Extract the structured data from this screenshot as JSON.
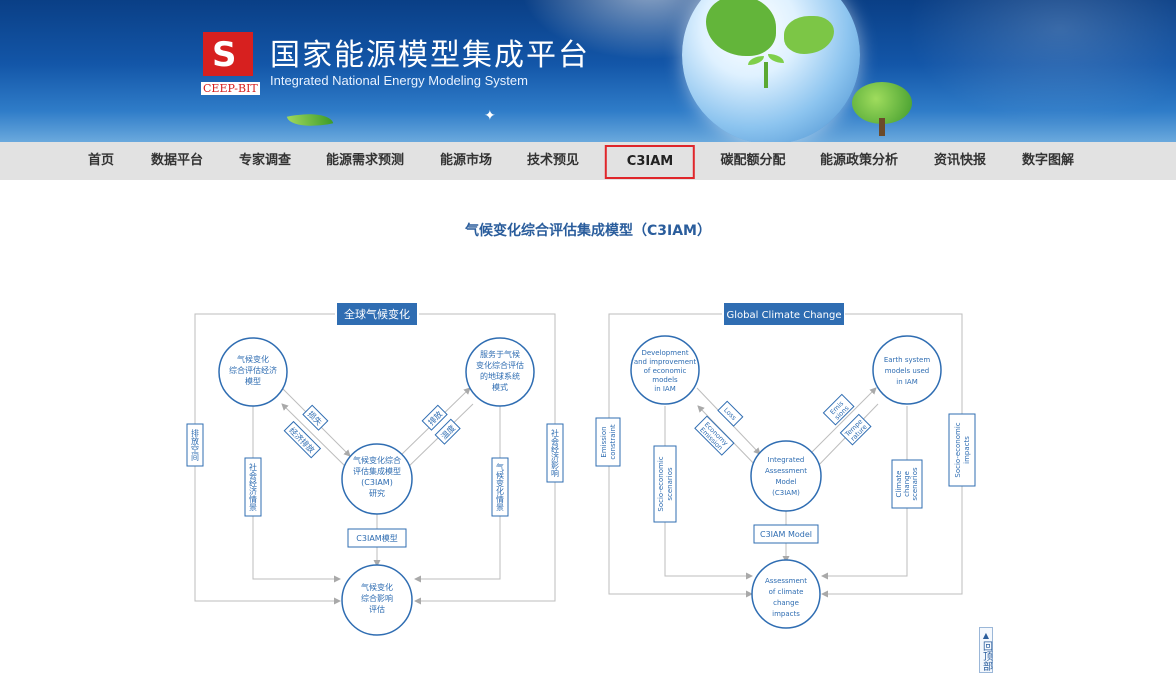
{
  "header": {
    "title": "国家能源模型集成平台",
    "subtitle": "Integrated National Energy Modeling System",
    "logo_text": "CEEP-BIT"
  },
  "nav": {
    "items": [
      {
        "label": "首页"
      },
      {
        "label": "数据平台"
      },
      {
        "label": "专家调查"
      },
      {
        "label": "能源需求预测"
      },
      {
        "label": "能源市场"
      },
      {
        "label": "技术预见"
      },
      {
        "label": "C3IAM",
        "active": true
      },
      {
        "label": "碳配额分配"
      },
      {
        "label": "能源政策分析"
      },
      {
        "label": "资讯快报"
      },
      {
        "label": "数字图解"
      }
    ]
  },
  "main": {
    "title": "气候变化综合评估集成模型（C3IAM）"
  },
  "diagram_cn": {
    "top": "全球气候变化",
    "left_circle": [
      "气候变化",
      "综合评估经济",
      "模型"
    ],
    "right_circle": [
      "服务于气候",
      "变化综合评估",
      "的地球系统",
      "模式"
    ],
    "center_circle": [
      "气候变化综合",
      "评估集成模型",
      "(C3IAM)",
      "研究"
    ],
    "bottom_circle": [
      "气候变化",
      "综合影响",
      "评估"
    ],
    "model_box": "C3IAM模型",
    "tag_left1": "损失",
    "tag_left2": "经济排放",
    "tag_right1": "排放",
    "tag_right2": "温度",
    "side_left": "排放空间",
    "side_right": "社会经济影响",
    "vert_left": "社会经济情景",
    "vert_right": "气候变化情景"
  },
  "diagram_en": {
    "top": "Global Climate Change",
    "left_circle": [
      "Development",
      "and improvement",
      "of economic",
      "models",
      "in IAM"
    ],
    "right_circle": [
      "Earth system",
      "models used",
      "in IAM"
    ],
    "center_circle": [
      "Integrated",
      "Assessment",
      "Model",
      "(C3IAM)"
    ],
    "bottom_circle": [
      "Assessment",
      "of climate",
      "change",
      "impacts"
    ],
    "model_box": "C3IAM Model",
    "tag_left1": "Loss",
    "tag_left2a": "Economy",
    "tag_left2b": "Emission",
    "tag_right1a": "Emis",
    "tag_right1b": "sions",
    "tag_right2a": "Tempe",
    "tag_right2b": "rature",
    "side_left_a": "Emission",
    "side_left_b": "constraint",
    "side_right_a": "Socio-economic",
    "side_right_b": "impacts",
    "vert_left_a": "Socio-economic",
    "vert_left_b": "scenarios",
    "vert_right_a": "Climate",
    "vert_right_b": "change",
    "vert_right_c": "scenarios"
  },
  "back_to_top": "回顶部",
  "colors": {
    "accent": "#2a6fb5",
    "nav_bg": "#e2e2e2",
    "active_border": "#e0262b",
    "title": "#2a5d9c"
  }
}
